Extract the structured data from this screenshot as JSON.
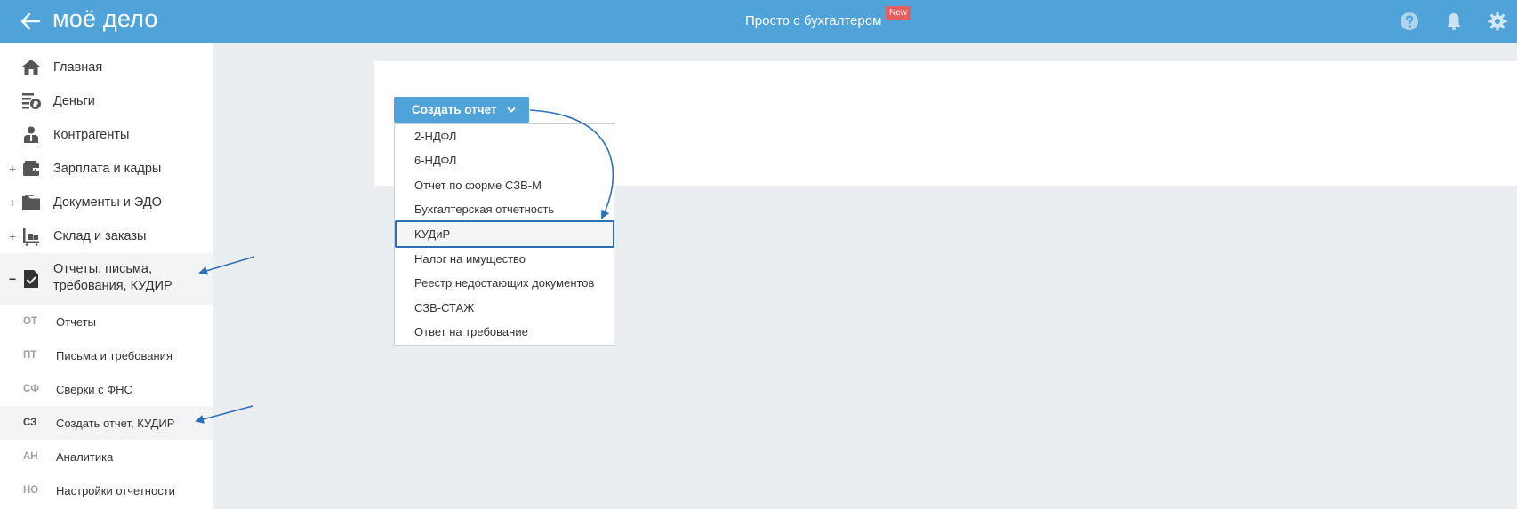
{
  "header": {
    "logo": "моё дело",
    "center_title": "Просто с бухгалтером",
    "new_badge": "New"
  },
  "sidebar": {
    "items": [
      {
        "label": "Главная",
        "icon": "home-icon"
      },
      {
        "label": "Деньги",
        "icon": "money-icon"
      },
      {
        "label": "Контрагенты",
        "icon": "contractors-icon"
      },
      {
        "label": "Зарплата и кадры",
        "icon": "wallet-icon",
        "expander": "+"
      },
      {
        "label": "Документы и ЭДО",
        "icon": "folder-icon",
        "expander": "+"
      },
      {
        "label": "Склад и заказы",
        "icon": "warehouse-icon",
        "expander": "+"
      },
      {
        "label_line1": "Отчеты, письма,",
        "label_line2": "требования, КУДИР",
        "icon": "report-check-icon",
        "expander": "−"
      }
    ],
    "subitems": [
      {
        "abbr": "ОТ",
        "label": "Отчеты"
      },
      {
        "abbr": "ПТ",
        "label": "Письма и требования"
      },
      {
        "abbr": "СФ",
        "label": "Сверки с ФНС"
      },
      {
        "abbr": "СЗ",
        "label": "Создать отчет, КУДИР"
      },
      {
        "abbr": "АН",
        "label": "Аналитика"
      },
      {
        "abbr": "НО",
        "label": "Настройки отчетности"
      }
    ]
  },
  "content": {
    "create_button": "Создать отчет",
    "dropdown": [
      "2-НДФЛ",
      "6-НДФЛ",
      "Отчет по форме СЗВ-М",
      "Бухгалтерская отчетность",
      "КУДиР",
      "Налог на имущество",
      "Реестр недостающих документов",
      "СЗВ-СТАЖ",
      "Ответ на требование"
    ],
    "highlighted_option": "КУДиР"
  },
  "colors": {
    "header": "#4fa3d9",
    "button": "#4fa3d9",
    "annotation_arrow": "#2e6fb6",
    "highlight_border": "#2e6fb6",
    "new_badge": "#e55d5d"
  }
}
